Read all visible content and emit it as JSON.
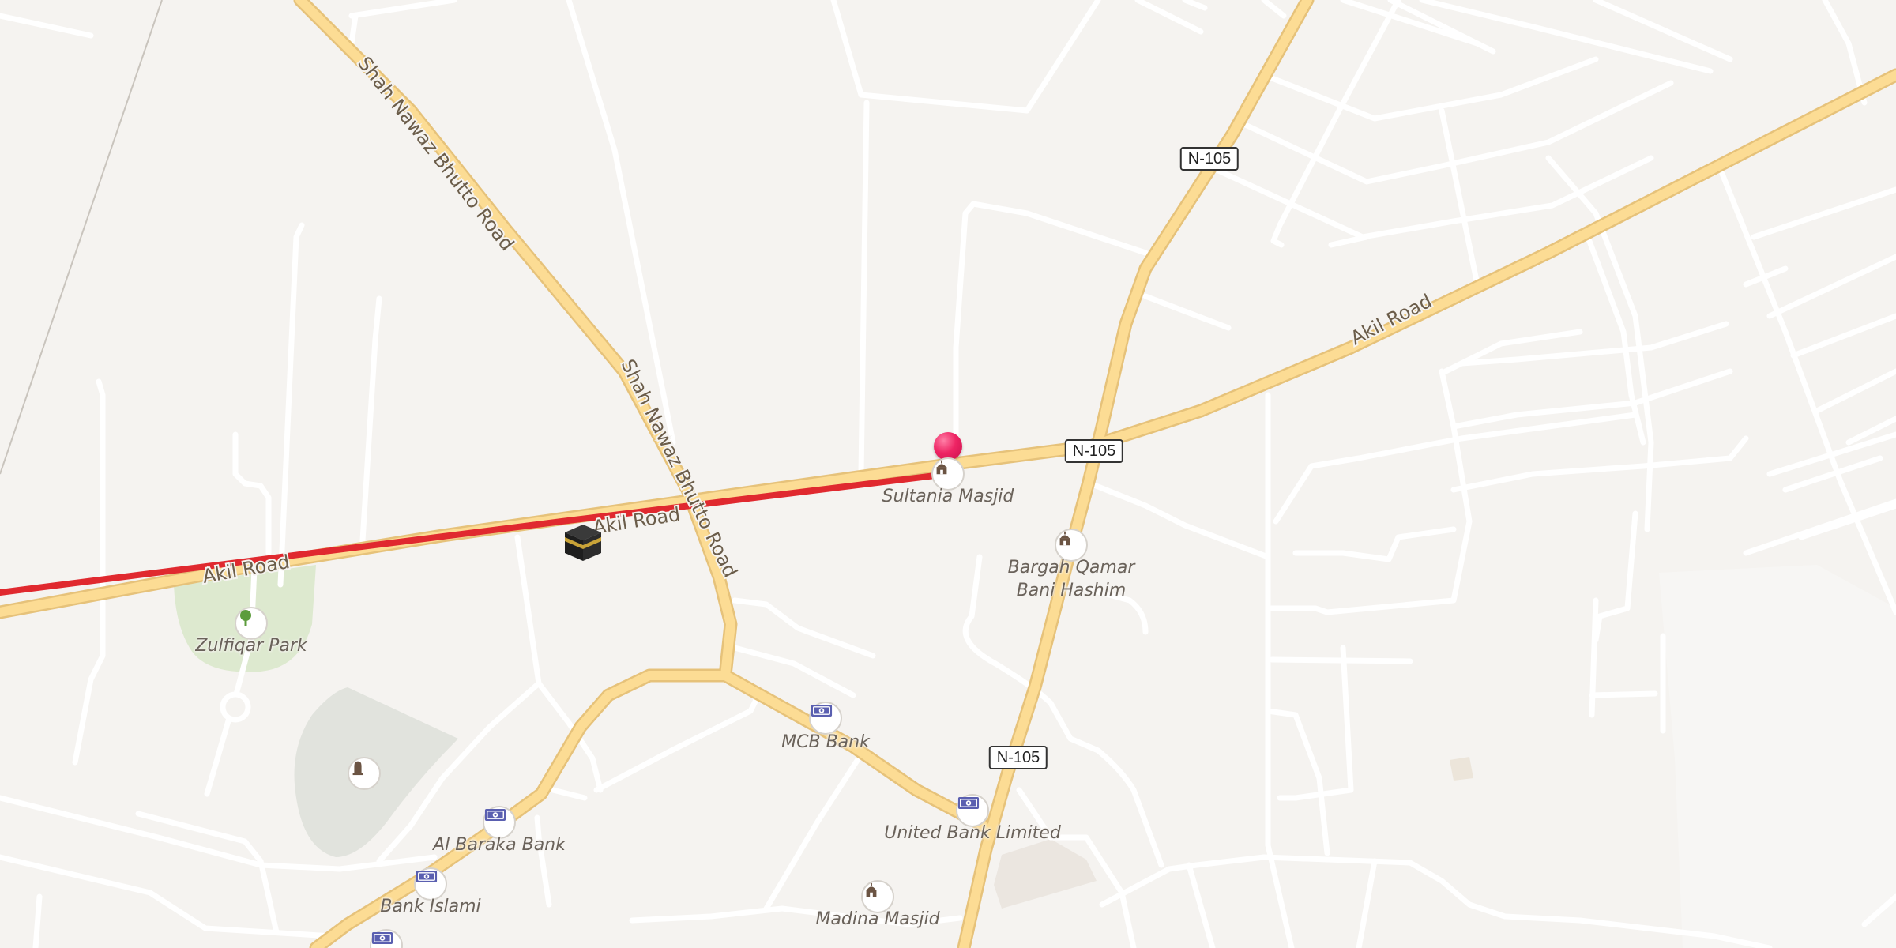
{
  "map": {
    "route_color": "#e0292f",
    "pin_color": "#ee2464",
    "major_road_color": "#fcdc94",
    "minor_road_color": "#ffffff",
    "background_color": "#f5f3f0",
    "park_color": "#dde9cf"
  },
  "roads": {
    "akil_road": "Akil Road",
    "shah_nawaz_bhutto_road": "Shah Nawaz Bhutto Road",
    "n105": "N-105"
  },
  "pois": [
    {
      "name": "Sultania Masjid",
      "icon": "mosque-icon"
    },
    {
      "name": "Bargah Qamar\nBani Hashim",
      "icon": "mosque-icon"
    },
    {
      "name": "Zulfiqar Park",
      "icon": "tree-icon"
    },
    {
      "name": "",
      "icon": "cemetery-icon"
    },
    {
      "name": "MCB Bank",
      "icon": "bank-icon"
    },
    {
      "name": "United Bank Limited",
      "icon": "bank-icon"
    },
    {
      "name": "Al Baraka Bank",
      "icon": "bank-icon"
    },
    {
      "name": "Bank Islami",
      "icon": "bank-icon"
    },
    {
      "name": "Madina Masjid",
      "icon": "mosque-icon"
    },
    {
      "name": "",
      "icon": "bank-icon"
    }
  ],
  "markers": {
    "destination": "destination-pin-icon",
    "origin": "kaaba-icon"
  }
}
